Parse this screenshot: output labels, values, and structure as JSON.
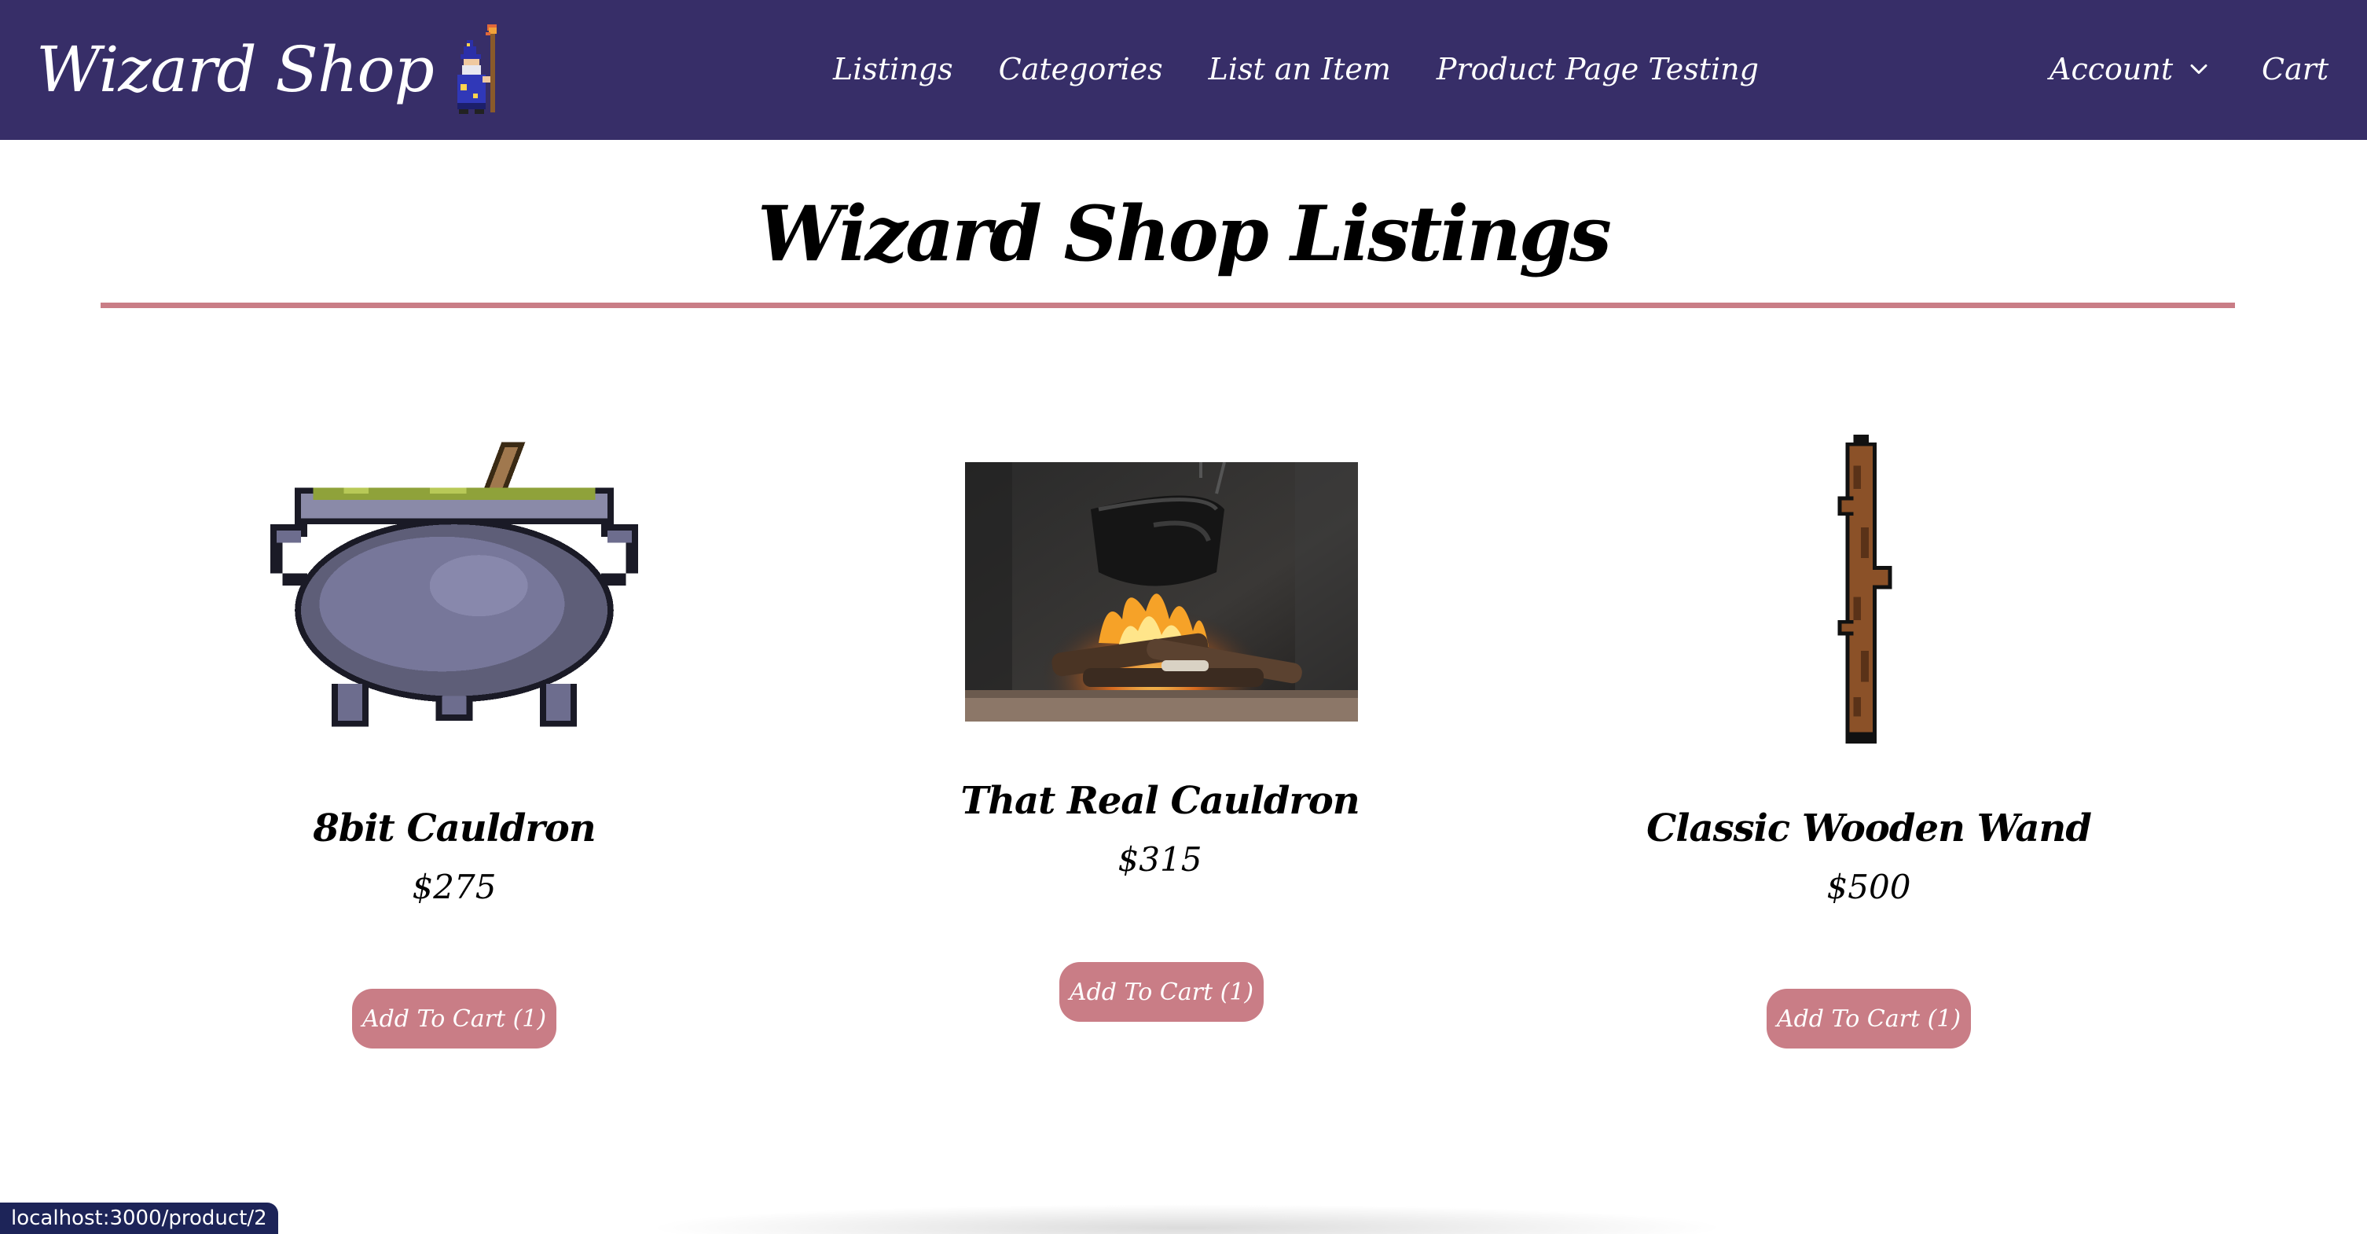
{
  "navbar": {
    "brand_title": "Wizard Shop",
    "links": [
      "Listings",
      "Categories",
      "List an Item",
      "Product Page Testing"
    ],
    "account_label": "Account",
    "cart_label": "Cart",
    "background": "#372e68"
  },
  "page": {
    "title": "Wizard Shop Listings",
    "accent": "#c97d86"
  },
  "products": [
    {
      "name": "8bit Cauldron",
      "price": "$275",
      "button": "Add To Cart (1)",
      "image": "pixel-cauldron"
    },
    {
      "name": "That Real Cauldron",
      "price": "$315",
      "button": "Add To Cart (1)",
      "image": "cauldron-over-fire-photo"
    },
    {
      "name": "Classic Wooden Wand",
      "price": "$500",
      "button": "Add To Cart (1)",
      "image": "pixel-wooden-wand"
    }
  ],
  "status_bar": {
    "url": "localhost:3000/product/2"
  }
}
